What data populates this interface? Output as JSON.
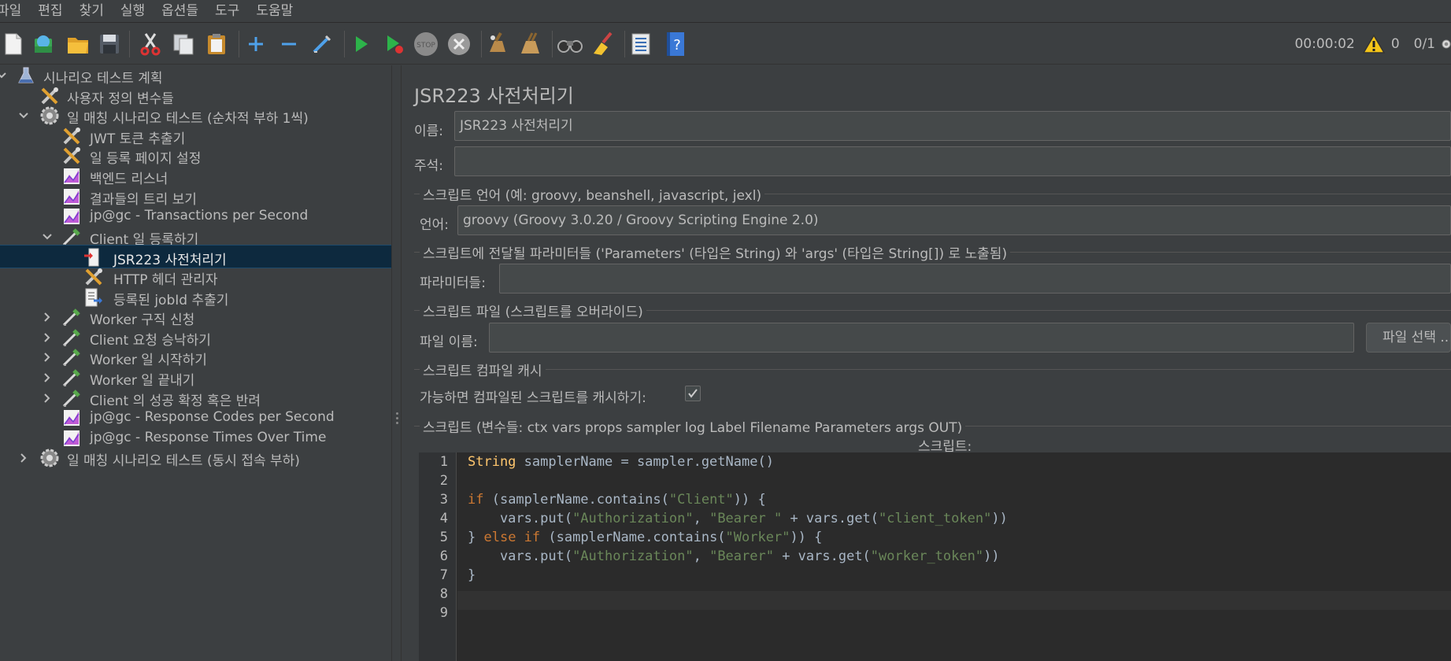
{
  "menu": [
    "파일",
    "편집",
    "찾기",
    "실행",
    "옵션들",
    "도구",
    "도움말"
  ],
  "toolbar": {
    "icons": [
      "new-icon",
      "templates-icon",
      "open-icon",
      "save-icon",
      "cut-icon",
      "copy-icon",
      "paste-icon",
      "expand-icon",
      "collapse-icon",
      "toggle-icon",
      "start-icon",
      "start-no-pause-icon",
      "stop-icon",
      "shutdown-icon",
      "clear-icon",
      "clear-all-icon",
      "search-icon",
      "reset-search-icon",
      "function-helper-icon",
      "help-icon"
    ],
    "elapsed": "00:00:02",
    "warnings": "0",
    "threads": "0/1"
  },
  "tree": [
    {
      "label": "시나리오 테스트 계획",
      "icon": "test-plan-icon",
      "indent": 0,
      "arrow": "expanded",
      "selected": false
    },
    {
      "label": "사용자 정의 변수들",
      "icon": "config-element-icon",
      "indent": 1,
      "arrow": "none",
      "selected": false
    },
    {
      "label": "일 매칭 시나리오 테스트 (순차적 부하 1씩)",
      "icon": "thread-group-icon",
      "indent": 1,
      "arrow": "expanded",
      "selected": false
    },
    {
      "label": "JWT 토큰 추출기",
      "icon": "config-element-icon",
      "indent": 2,
      "arrow": "none",
      "selected": false
    },
    {
      "label": "일 등록 페이지 설정",
      "icon": "config-element-icon",
      "indent": 2,
      "arrow": "none",
      "selected": false
    },
    {
      "label": "백엔드 리스너",
      "icon": "listener-icon",
      "indent": 2,
      "arrow": "none",
      "selected": false
    },
    {
      "label": "결과들의 트리 보기",
      "icon": "listener-icon",
      "indent": 2,
      "arrow": "none",
      "selected": false
    },
    {
      "label": "jp@gc - Transactions per Second",
      "icon": "listener-icon",
      "indent": 2,
      "arrow": "none",
      "selected": false
    },
    {
      "label": "Client 일 등록하기",
      "icon": "sampler-icon",
      "indent": 2,
      "arrow": "expanded",
      "selected": false
    },
    {
      "label": "JSR223 사전처리기",
      "icon": "preprocessor-icon",
      "indent": 3,
      "arrow": "none",
      "selected": true
    },
    {
      "label": "HTTP 헤더 관리자",
      "icon": "config-element-icon",
      "indent": 3,
      "arrow": "none",
      "selected": false
    },
    {
      "label": "등록된 jobId 추출기",
      "icon": "postprocessor-icon",
      "indent": 3,
      "arrow": "none",
      "selected": false
    },
    {
      "label": "Worker 구직 신청",
      "icon": "sampler-icon",
      "indent": 2,
      "arrow": "collapsed",
      "selected": false
    },
    {
      "label": "Client 요청 승낙하기",
      "icon": "sampler-icon",
      "indent": 2,
      "arrow": "collapsed",
      "selected": false
    },
    {
      "label": "Worker 일 시작하기",
      "icon": "sampler-icon",
      "indent": 2,
      "arrow": "collapsed",
      "selected": false
    },
    {
      "label": "Worker 일 끝내기",
      "icon": "sampler-icon",
      "indent": 2,
      "arrow": "collapsed",
      "selected": false
    },
    {
      "label": "Client 의 성공 확정 혹은 반려",
      "icon": "sampler-icon",
      "indent": 2,
      "arrow": "collapsed",
      "selected": false
    },
    {
      "label": "jp@gc - Response Codes per Second",
      "icon": "listener-icon",
      "indent": 2,
      "arrow": "none",
      "selected": false
    },
    {
      "label": "jp@gc - Response Times Over Time",
      "icon": "listener-icon",
      "indent": 2,
      "arrow": "none",
      "selected": false
    },
    {
      "label": "일 매칭 시나리오 테스트 (동시 접속 부하)",
      "icon": "thread-group-icon",
      "indent": 1,
      "arrow": "collapsed",
      "selected": false
    }
  ],
  "editor": {
    "title": "JSR223 사전처리기",
    "name_label": "이름:",
    "name_value": "JSR223 사전처리기",
    "comment_label": "주석:",
    "comment_value": "",
    "lang_section": "스크립트 언어 (예: groovy, beanshell, javascript, jexl)",
    "lang_label": "언어:",
    "lang_value": "groovy     (Groovy 3.0.20 / Groovy Scripting Engine 2.0)",
    "params_section": "스크립트에 전달될 파라미터들 ('Parameters' (타입은 String) 와 'args' (타입은 String[]) 로 노출됨)",
    "params_label": "파라미터들:",
    "params_value": "",
    "file_section": "스크립트 파일 (스크립트를 오버라이드)",
    "file_label": "파일 이름:",
    "file_value": "",
    "file_button": "파일 선택 ...",
    "cache_section": "스크립트 컴파일 캐시",
    "cache_label": "가능하면 컴파일된 스크립트를 캐시하기:",
    "cache_checked": true,
    "script_section": "스크립트 (변수들: ctx vars props sampler log Label Filename Parameters args OUT)",
    "script_label": "스크립트:"
  },
  "code": [
    [
      {
        "t": "String",
        "c": "ty"
      },
      {
        "t": " samplerName = sampler.getName()",
        "c": ""
      }
    ],
    [],
    [
      {
        "t": "if",
        "c": "kw"
      },
      {
        "t": " (samplerName.contains(",
        "c": ""
      },
      {
        "t": "\"Client\"",
        "c": "str"
      },
      {
        "t": ")) {",
        "c": ""
      }
    ],
    [
      {
        "t": "    vars.put(",
        "c": ""
      },
      {
        "t": "\"Authorization\"",
        "c": "str"
      },
      {
        "t": ", ",
        "c": ""
      },
      {
        "t": "\"Bearer \"",
        "c": "str"
      },
      {
        "t": " + vars.get(",
        "c": ""
      },
      {
        "t": "\"client_token\"",
        "c": "str"
      },
      {
        "t": "))",
        "c": ""
      }
    ],
    [
      {
        "t": "} ",
        "c": ""
      },
      {
        "t": "else if",
        "c": "kw"
      },
      {
        "t": " (samplerName.contains(",
        "c": ""
      },
      {
        "t": "\"Worker\"",
        "c": "str"
      },
      {
        "t": ")) {",
        "c": ""
      }
    ],
    [
      {
        "t": "    vars.put(",
        "c": ""
      },
      {
        "t": "\"Authorization\"",
        "c": "str"
      },
      {
        "t": ", ",
        "c": ""
      },
      {
        "t": "\"Bearer\"",
        "c": "str"
      },
      {
        "t": " + vars.get(",
        "c": ""
      },
      {
        "t": "\"worker_token\"",
        "c": "str"
      },
      {
        "t": "))",
        "c": ""
      }
    ],
    [
      {
        "t": "}",
        "c": ""
      }
    ],
    [],
    []
  ]
}
